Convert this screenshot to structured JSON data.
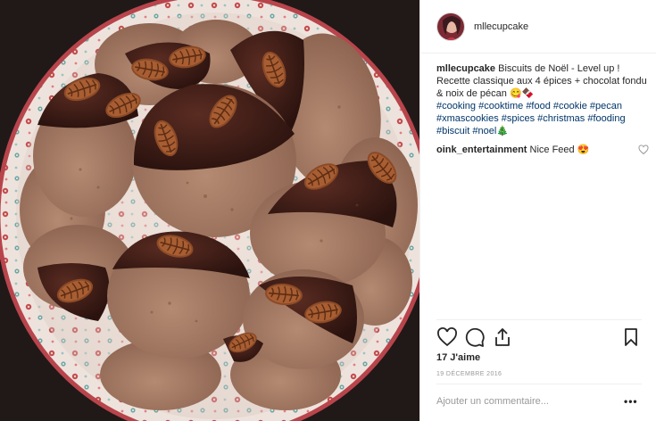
{
  "post": {
    "author": "mllecupcake",
    "caption": "Biscuits de Noël - Level up ! Recette classique aux 4 épices + chocolat fondu & noix de pécan 😋🍫",
    "hashtags": [
      "#cooking",
      "#cooktime",
      "#food",
      "#cookie",
      "#pecan",
      "#xmascookies",
      "#spices",
      "#christmas",
      "#fooding",
      "#biscuit",
      "#noel🎄"
    ],
    "photo_subject": "chocolate-dipped spice cookies with pecans on a floral plate"
  },
  "comments": [
    {
      "user": "oink_entertainment",
      "text": "Nice Feed 😍"
    }
  ],
  "likes_text": "17 J'aime",
  "date_text": "19 DÉCEMBRE 2016",
  "add_comment_placeholder": "Ajouter un commentaire...",
  "more_label": "•••",
  "icons": {
    "like": "heart-icon",
    "comment": "comment-icon",
    "share": "share-icon",
    "save": "bookmark-icon",
    "comment_like": "heart-icon"
  },
  "colors": {
    "hashtag": "#003569",
    "muted": "#999999",
    "text": "#262626",
    "border": "#efefef"
  }
}
